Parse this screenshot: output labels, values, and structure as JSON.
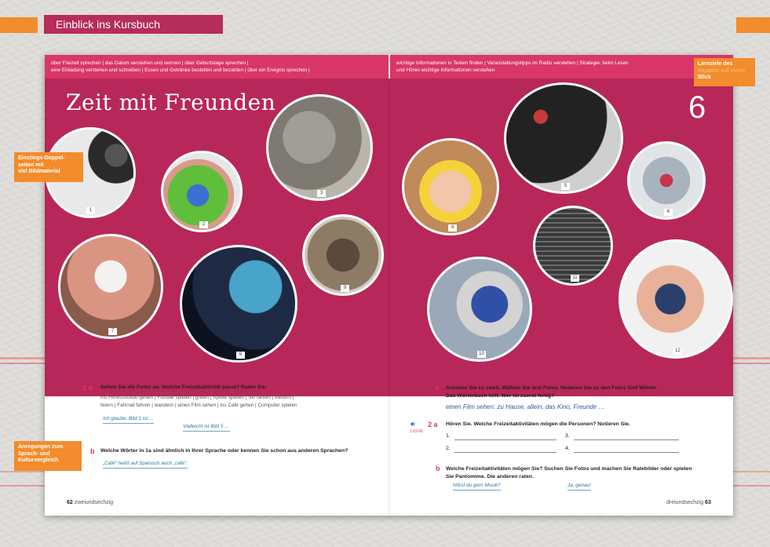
{
  "header": {
    "title": "Einblick ins Kursbuch"
  },
  "left_page": {
    "topbar": [
      "über Freizeit sprechen | das Datum verstehen und nennen | über Geburtstage sprechen |",
      "eine Einladung verstehen und schreiben | Essen und Getränke bestellen und bezahlen | über ein Ereignis sprechen |"
    ],
    "headline": "Zeit mit Freunden",
    "photo_numbers": [
      "1",
      "2",
      "3",
      "7",
      "8",
      "9"
    ],
    "task_1a": {
      "num": "1 a",
      "instruction": "Sehen Sie die Fotos an. Welche Freizeitaktivität passt? Raten Sie.",
      "words_line1": "ins Fitnessstudio gehen  |  Fußball spielen  |  grillen  |  Spiele spielen  |  Ski fahren  |  klettern  |",
      "words_line2": "feiern  |  Fahrrad fahren  |  wandern  |  einen Film sehen  |  ins Café gehen  |  Computer spielen",
      "bubble1": "Ich glaube, Bild 1 ist …",
      "bubble2": "Vielleicht ist Bild 5 …"
    },
    "task_1b": {
      "num": "b",
      "instruction": "Welche Wörter in 1a sind ähnlich in Ihrer Sprache oder kennen Sie schon aus anderen Sprachen?",
      "bubble": "„Café“ heißt auf Spanisch auch „café“."
    },
    "page_number": "62",
    "page_word": "zweiundsechzig"
  },
  "right_page": {
    "topbar": [
      "wichtige Informationen in Texten finden | Veranstaltungstipps im Radio verstehen | Strategie: beim Lesen",
      "und Hören wichtige Informationen verstehen"
    ],
    "chapter_number": "6",
    "photo_numbers": [
      "4",
      "5",
      "6",
      "10",
      "11",
      "12"
    ],
    "task_1c": {
      "num": "c",
      "instruction_line1": "Arbeiten Sie zu zweit. Wählen Sie drei Fotos. Notieren Sie zu den Fotos fünf Wörter.",
      "instruction_line2": "Das Wörterbuch hilft. Wer ist zuerst fertig?",
      "handwritten": "einen Film sehen: zu Hause, allein, das Kino, Freunde …"
    },
    "task_2a": {
      "num": "2 a",
      "audio_label": "1.63-66",
      "instruction": "Hören Sie. Welche Freizeitaktivitäten mögen die Personen? Notieren Sie.",
      "labels": [
        "1.",
        "2.",
        "3.",
        "4."
      ]
    },
    "task_2b": {
      "num": "b",
      "instruction_line1": "Welche Freizeitaktivitäten mögen Sie? Suchen Sie Fotos und machen Sie Ratebilder oder spielen",
      "instruction_line2": "Sie Pantomime. Die anderen raten.",
      "bubble1": "Hörst du gern Musik?",
      "bubble2": "Ja, genau!"
    },
    "page_number": "63",
    "page_word": "dreiundsechzig"
  },
  "side_notes": {
    "lernziele": [
      "Lernziele des",
      "Kapitels auf einen",
      "Blick"
    ],
    "einstieg": [
      "Einstiegs-Doppel-",
      "seiten mit",
      "viel Bildmaterial"
    ],
    "anregungen": [
      "Anregungen zum",
      "Sprach- und",
      "Kulturvergleich"
    ]
  },
  "colors": {
    "magenta": "#b8275a",
    "pink_bar": "#d9366a",
    "orange": "#f28c2c"
  }
}
